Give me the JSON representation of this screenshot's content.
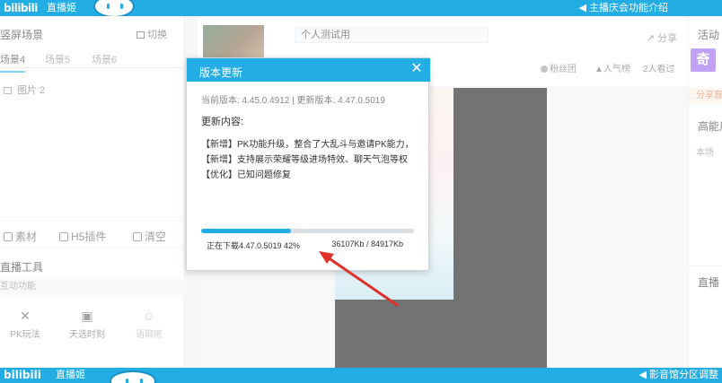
{
  "topbar": {
    "logo": "bilibili",
    "app_name": "直播姬",
    "notice": "主播庆会功能介绍"
  },
  "bottombar": {
    "logo": "bilibili",
    "app_name": "直播姬",
    "notice": "影音馆分区调整"
  },
  "left_panel": {
    "title": "竖屏场景",
    "switch_label": "切换",
    "tabs": [
      {
        "label": "场景4",
        "active": true
      },
      {
        "label": "场景5",
        "active": false
      },
      {
        "label": "场景6",
        "active": false
      }
    ],
    "source_item": "图片 2",
    "actions": [
      {
        "label": "素材",
        "icon": "plus-square-icon"
      },
      {
        "label": "H5插件",
        "icon": "puzzle-icon"
      },
      {
        "label": "清空",
        "icon": "trash-icon"
      }
    ],
    "tools_title": "直播工具",
    "tools_subtitle": "互动功能",
    "tools": [
      {
        "label": "PK玩法",
        "icon": "pk-icon",
        "disabled": false
      },
      {
        "label": "天选时刻",
        "icon": "gift-icon",
        "disabled": false
      },
      {
        "label": "语聊房",
        "icon": "users-icon",
        "disabled": true
      }
    ]
  },
  "center_panel": {
    "room_title": "个人测试用",
    "share_label": "分享",
    "fans_label": "粉丝团",
    "popularity_label": "人气榜",
    "viewers": "2人看过"
  },
  "right_panel": {
    "activity_label": "活动",
    "badge": "奇",
    "share_label": "分享直",
    "section_title": "高能用",
    "section_small": "本场",
    "bottom_label": "直播"
  },
  "dialog": {
    "title": "版本更新",
    "version_line": "当前版本: 4.45.0.4912 | 更新版本: 4.47.0.5019",
    "content_label": "更新内容:",
    "items": [
      "【新增】PK功能升级，整合了大乱斗与邀请PK能力，",
      "【新增】支持展示荣耀等级进场特效、聊天气泡等权",
      "【优化】已知问题修复"
    ],
    "progress_percent": 42,
    "status": "正在下载4.47.0.5019  42%",
    "bytes": "36107Kb / 84917Kb"
  },
  "colors": {
    "brand": "#23ade5",
    "annotation_arrow": "#e0302a",
    "badge": "#8e54e9"
  }
}
